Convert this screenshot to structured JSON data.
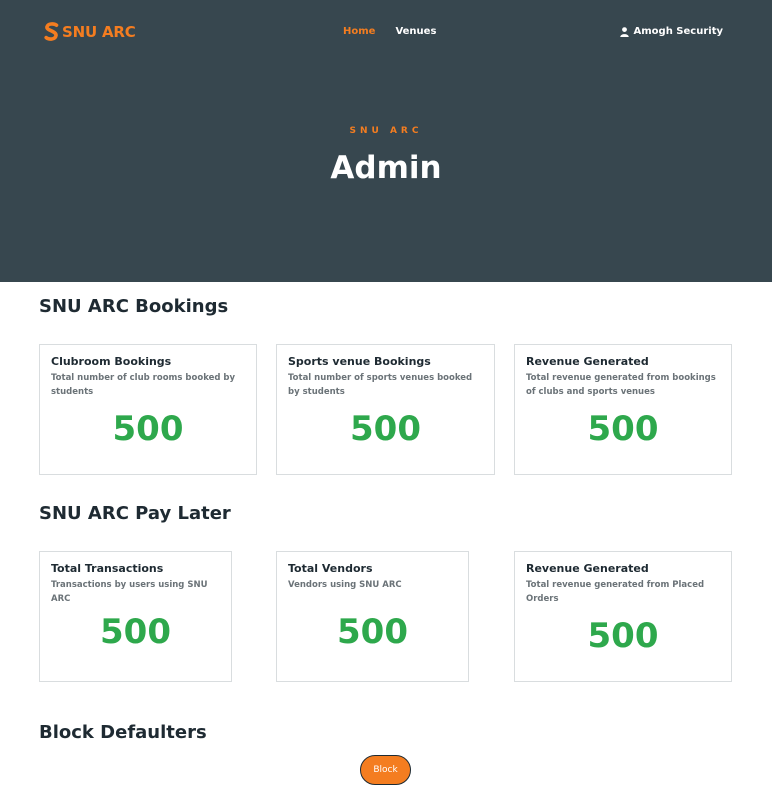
{
  "brand": {
    "name": "SNU ARC"
  },
  "nav": {
    "home": "Home",
    "venues": "Venues"
  },
  "user": {
    "name": "Amogh Security"
  },
  "hero": {
    "kicker": "SNU ARC",
    "title": "Admin"
  },
  "bookings": {
    "title": "SNU ARC Bookings",
    "cards": [
      {
        "title": "Clubroom Bookings",
        "desc": "Total number of club rooms booked by students",
        "value": "500"
      },
      {
        "title": "Sports venue Bookings",
        "desc": "Total number of sports venues booked by students",
        "value": "500"
      },
      {
        "title": "Revenue Generated",
        "desc": "Total revenue generated from bookings of clubs and sports venues",
        "value": "500"
      }
    ]
  },
  "paylater": {
    "title": "SNU ARC Pay Later",
    "cards": [
      {
        "title": "Total Transactions",
        "desc": "Transactions by users using SNU ARC",
        "value": "500"
      },
      {
        "title": "Total Vendors",
        "desc": "Vendors using SNU ARC",
        "value": "500"
      },
      {
        "title": "Revenue Generated",
        "desc": "Total revenue generated from Placed Orders",
        "value": "500"
      }
    ]
  },
  "defaulters": {
    "title": "Block Defaulters",
    "button": "Block"
  },
  "colors": {
    "header_bg": "#37474f",
    "accent": "#f47d20",
    "value_green": "#2ea84c"
  }
}
